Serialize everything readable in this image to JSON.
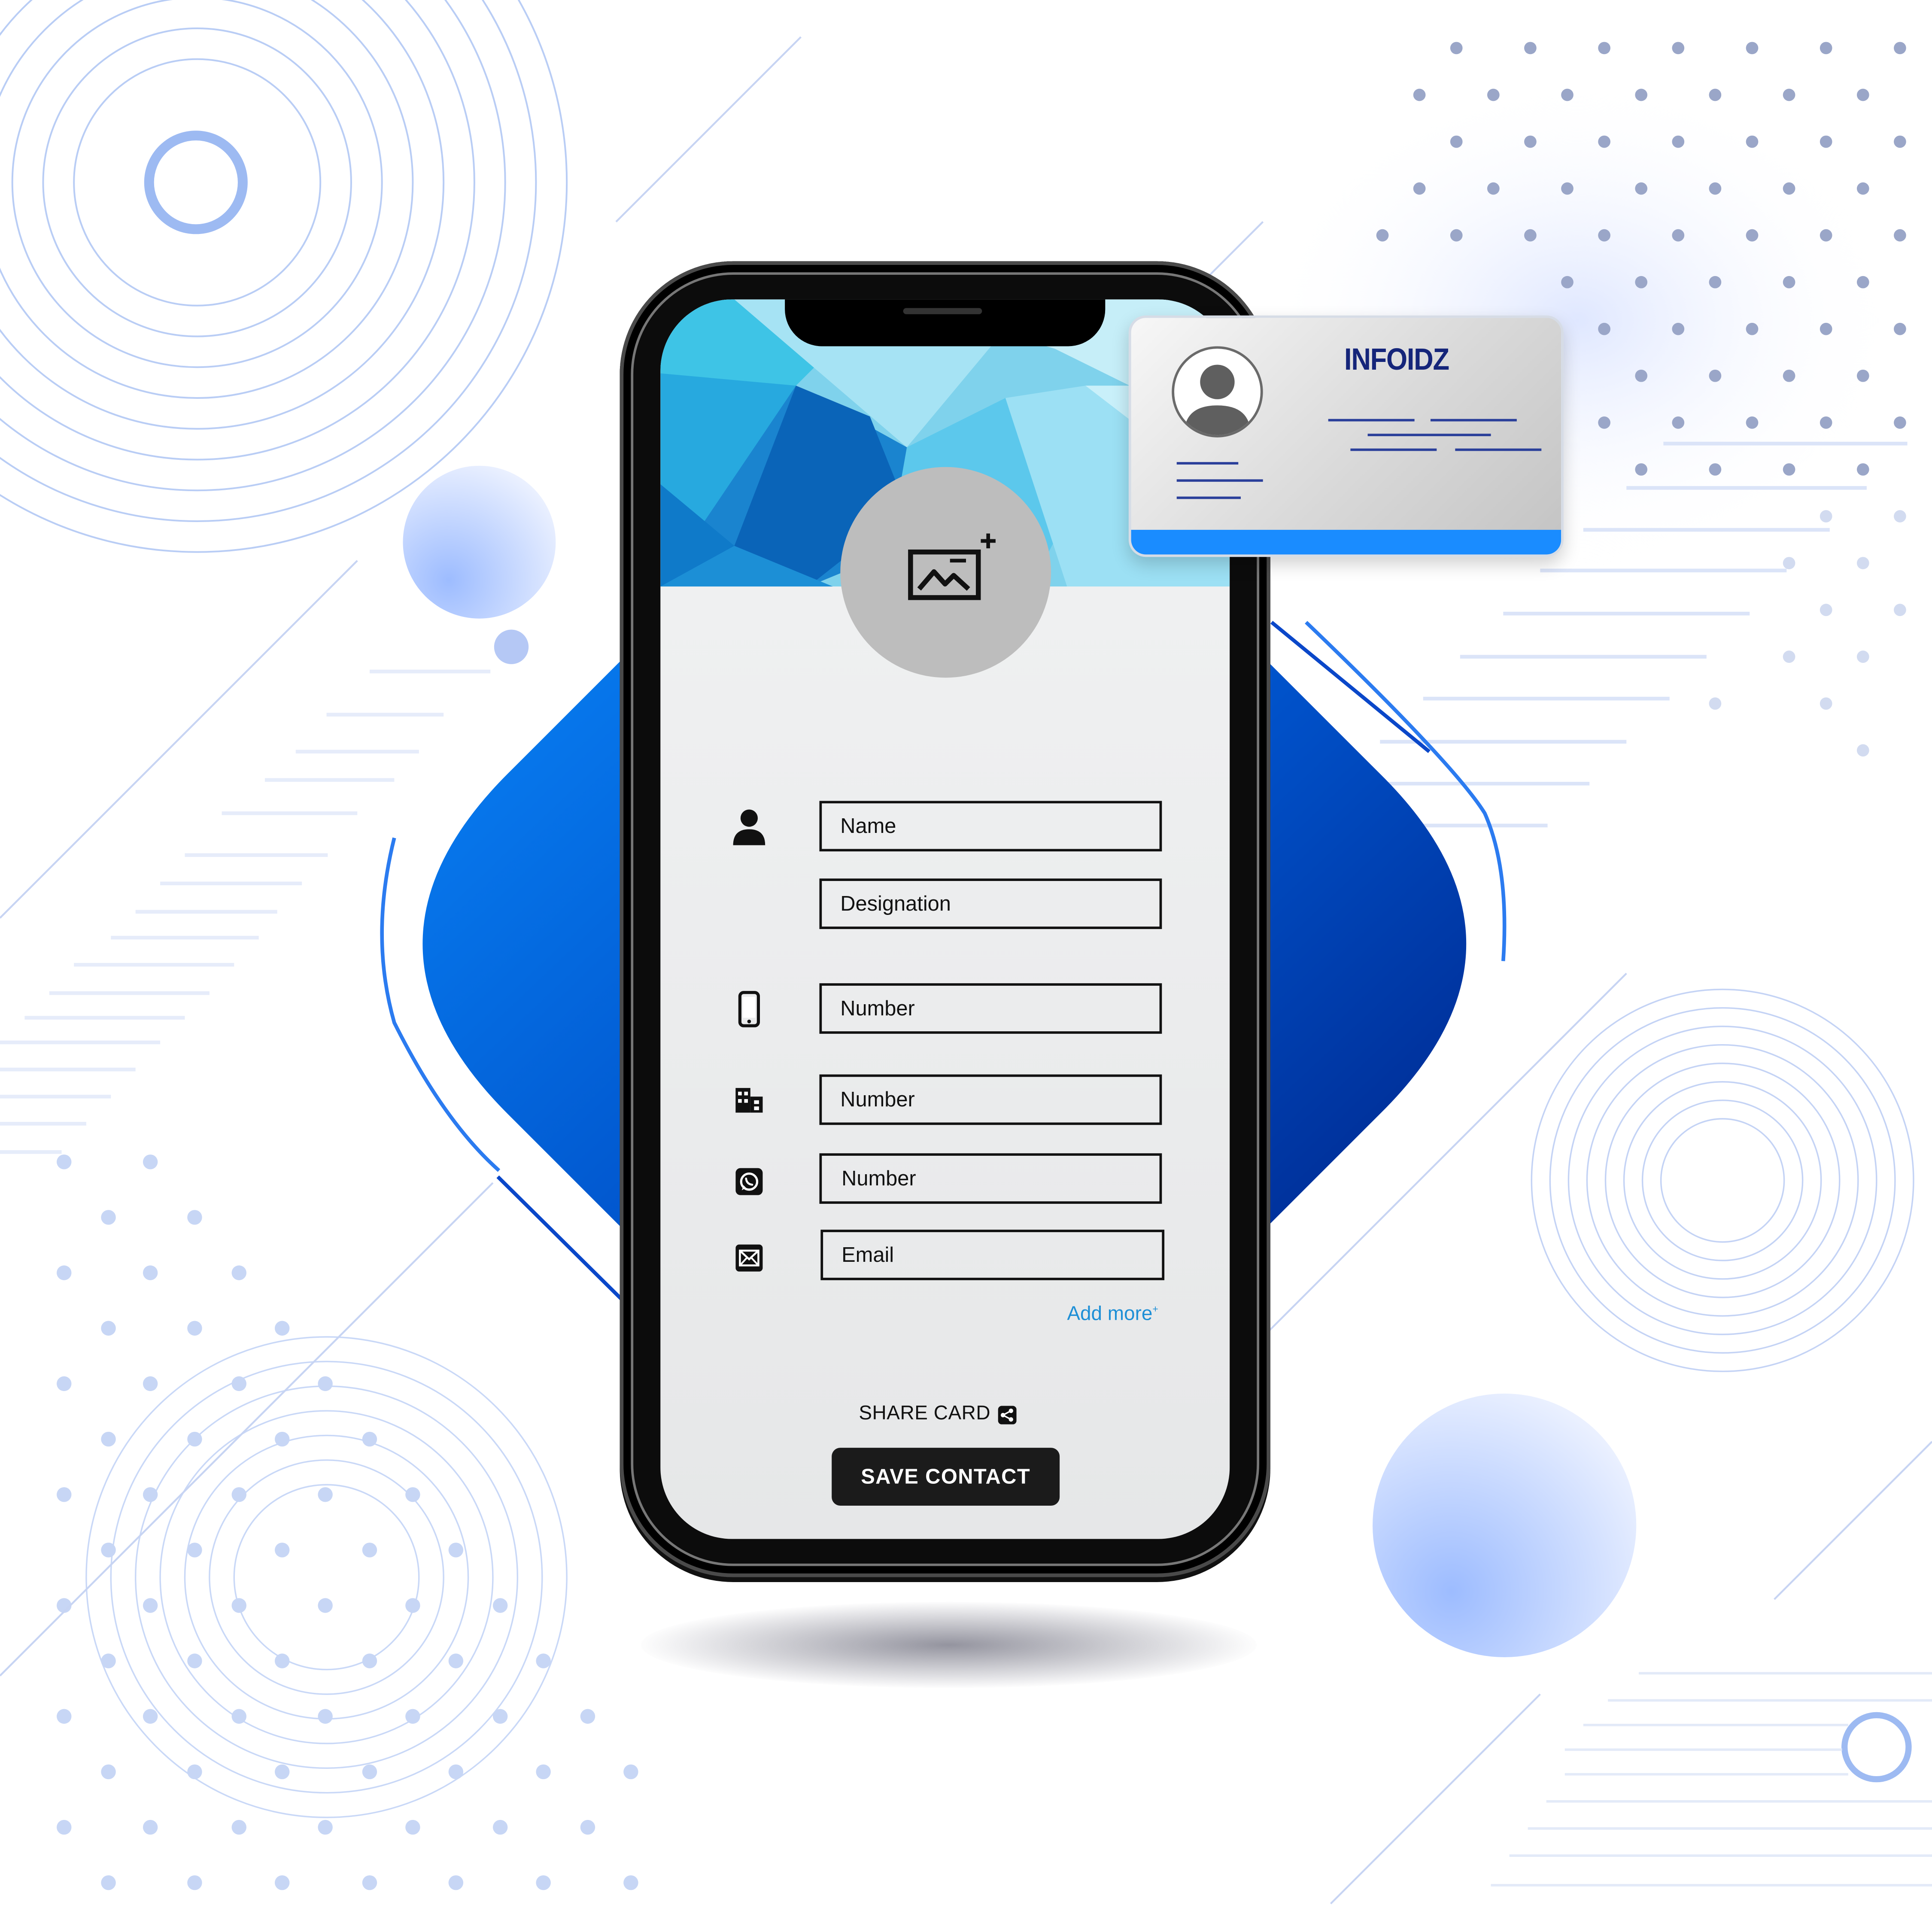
{
  "form": {
    "name_placeholder": "Name",
    "designation_placeholder": "Designation",
    "mobile_placeholder": "Number",
    "office_placeholder": "Number",
    "whatsapp_placeholder": "Number",
    "email_placeholder": "Email",
    "add_more_label": "Add more",
    "add_more_mark": "+"
  },
  "actions": {
    "share_label": "SHARE CARD",
    "save_label": "SAVE CONTACT"
  },
  "card": {
    "brand": "INFOIDZ"
  },
  "icons": {
    "photo": "add-image-icon",
    "name": "person-icon",
    "mobile": "mobile-phone-icon",
    "office": "building-icon",
    "whatsapp": "whatsapp-icon",
    "email": "envelope-icon",
    "share": "share-icon"
  },
  "colors": {
    "accent": "#1a8cff",
    "diamond_dark": "#001a7a",
    "button_bg": "#1b1b1b",
    "link": "#1e8fd6",
    "brand_text": "#15257a"
  }
}
